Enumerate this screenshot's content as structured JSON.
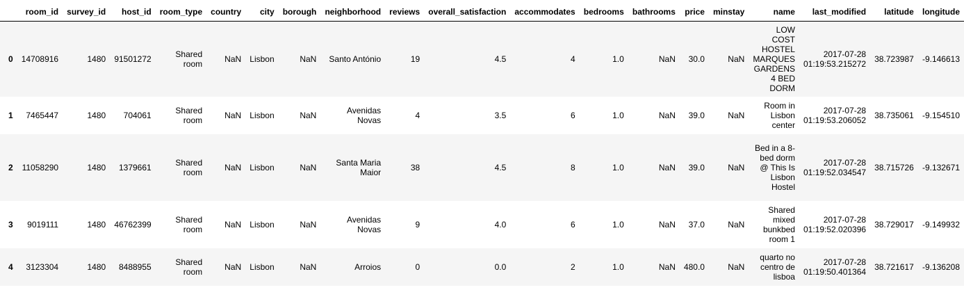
{
  "table": {
    "columns": [
      "",
      "room_id",
      "survey_id",
      "host_id",
      "room_type",
      "country",
      "city",
      "borough",
      "neighborhood",
      "reviews",
      "overall_satisfaction",
      "accommodates",
      "bedrooms",
      "bathrooms",
      "price",
      "minstay",
      "name",
      "last_modified",
      "latitude",
      "longitude"
    ],
    "rows": [
      {
        "index": "0",
        "room_id": "14708916",
        "survey_id": "1480",
        "host_id": "91501272",
        "room_type": "Shared room",
        "country": "NaN",
        "city": "Lisbon",
        "borough": "NaN",
        "neighborhood": "Santo António",
        "reviews": "19",
        "overall_satisfaction": "4.5",
        "accommodates": "4",
        "bedrooms": "1.0",
        "bathrooms": "NaN",
        "price": "30.0",
        "minstay": "NaN",
        "name": "LOW COST HOSTEL MARQUES GARDENS 4 BED DORM",
        "last_modified": "2017-07-28 01:19:53.215272",
        "latitude": "38.723987",
        "longitude": "-9.146613"
      },
      {
        "index": "1",
        "room_id": "7465447",
        "survey_id": "1480",
        "host_id": "704061",
        "room_type": "Shared room",
        "country": "NaN",
        "city": "Lisbon",
        "borough": "NaN",
        "neighborhood": "Avenidas Novas",
        "reviews": "4",
        "overall_satisfaction": "3.5",
        "accommodates": "6",
        "bedrooms": "1.0",
        "bathrooms": "NaN",
        "price": "39.0",
        "minstay": "NaN",
        "name": "Room in Lisbon center",
        "last_modified": "2017-07-28 01:19:53.206052",
        "latitude": "38.735061",
        "longitude": "-9.154510"
      },
      {
        "index": "2",
        "room_id": "11058290",
        "survey_id": "1480",
        "host_id": "1379661",
        "room_type": "Shared room",
        "country": "NaN",
        "city": "Lisbon",
        "borough": "NaN",
        "neighborhood": "Santa Maria Maior",
        "reviews": "38",
        "overall_satisfaction": "4.5",
        "accommodates": "8",
        "bedrooms": "1.0",
        "bathrooms": "NaN",
        "price": "39.0",
        "minstay": "NaN",
        "name": "Bed in a 8-bed dorm @ This Is Lisbon Hostel",
        "last_modified": "2017-07-28 01:19:52.034547",
        "latitude": "38.715726",
        "longitude": "-9.132671"
      },
      {
        "index": "3",
        "room_id": "9019111",
        "survey_id": "1480",
        "host_id": "46762399",
        "room_type": "Shared room",
        "country": "NaN",
        "city": "Lisbon",
        "borough": "NaN",
        "neighborhood": "Avenidas Novas",
        "reviews": "9",
        "overall_satisfaction": "4.0",
        "accommodates": "6",
        "bedrooms": "1.0",
        "bathrooms": "NaN",
        "price": "37.0",
        "minstay": "NaN",
        "name": "Shared mixed bunkbed room 1",
        "last_modified": "2017-07-28 01:19:52.020396",
        "latitude": "38.729017",
        "longitude": "-9.149932"
      },
      {
        "index": "4",
        "room_id": "3123304",
        "survey_id": "1480",
        "host_id": "8488955",
        "room_type": "Shared room",
        "country": "NaN",
        "city": "Lisbon",
        "borough": "NaN",
        "neighborhood": "Arroios",
        "reviews": "0",
        "overall_satisfaction": "0.0",
        "accommodates": "2",
        "bedrooms": "1.0",
        "bathrooms": "NaN",
        "price": "480.0",
        "minstay": "NaN",
        "name": "quarto no centro de lisboa",
        "last_modified": "2017-07-28 01:19:50.401364",
        "latitude": "38.721617",
        "longitude": "-9.136208"
      }
    ]
  }
}
